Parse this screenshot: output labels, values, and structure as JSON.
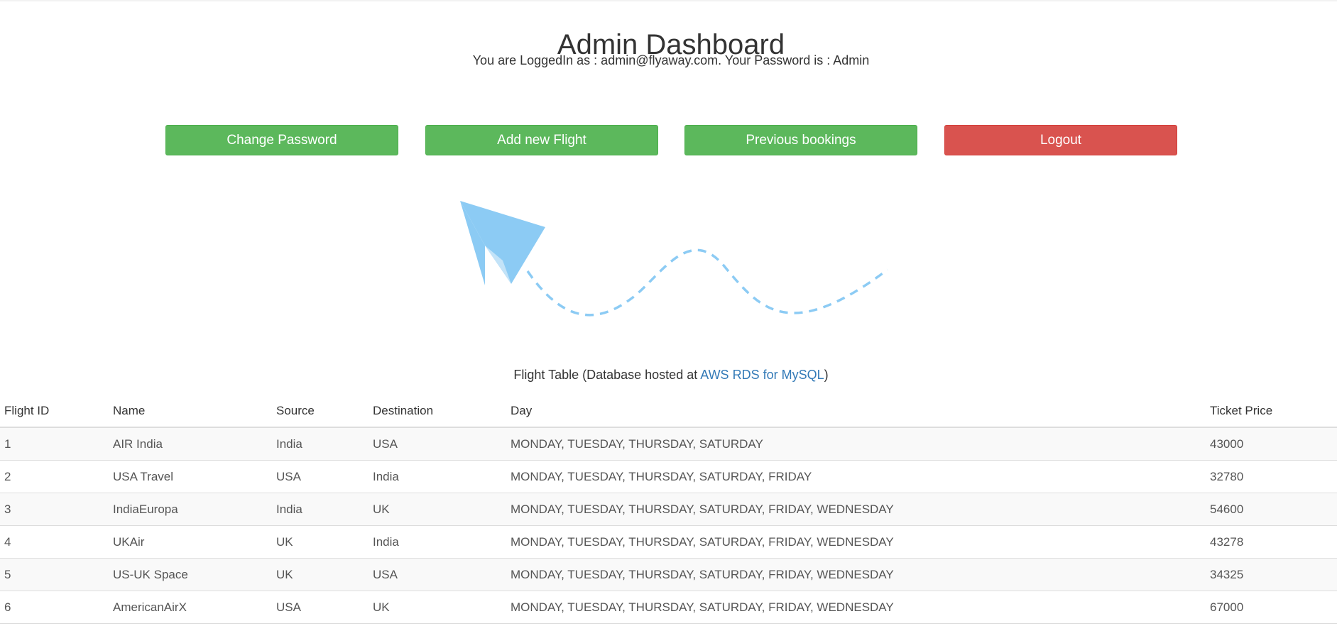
{
  "page": {
    "title": "Admin Dashboard",
    "login_info": "You are LoggedIn as : admin@flyaway.com. Your Password is : Admin"
  },
  "buttons": {
    "change_password": "Change Password",
    "add_flight": "Add new Flight",
    "previous_bookings": "Previous bookings",
    "logout": "Logout"
  },
  "illustration": {
    "icon": "paper-plane-icon",
    "color": "#8ccbf4"
  },
  "caption": {
    "prefix": "Flight Table (Database hosted at ",
    "link_text": "AWS RDS for MySQL",
    "suffix": ")"
  },
  "table": {
    "headers": [
      "Flight ID",
      "Name",
      "Source",
      "Destination",
      "Day",
      "Ticket Price"
    ],
    "rows": [
      [
        "1",
        "AIR India",
        "India",
        "USA",
        "MONDAY, TUESDAY, THURSDAY, SATURDAY",
        "43000"
      ],
      [
        "2",
        "USA Travel",
        "USA",
        "India",
        "MONDAY, TUESDAY, THURSDAY, SATURDAY, FRIDAY",
        "32780"
      ],
      [
        "3",
        "IndiaEuropa",
        "India",
        "UK",
        "MONDAY, TUESDAY, THURSDAY, SATURDAY, FRIDAY, WEDNESDAY",
        "54600"
      ],
      [
        "4",
        "UKAir",
        "UK",
        "India",
        "MONDAY, TUESDAY, THURSDAY, SATURDAY, FRIDAY, WEDNESDAY",
        "43278"
      ],
      [
        "5",
        "US-UK Space",
        "UK",
        "USA",
        "MONDAY, TUESDAY, THURSDAY, SATURDAY, FRIDAY, WEDNESDAY",
        "34325"
      ],
      [
        "6",
        "AmericanAirX",
        "USA",
        "UK",
        "MONDAY, TUESDAY, THURSDAY, SATURDAY, FRIDAY, WEDNESDAY",
        "67000"
      ]
    ]
  },
  "colors": {
    "success": "#5cb85c",
    "danger": "#d9534f",
    "link": "#337ab7"
  }
}
